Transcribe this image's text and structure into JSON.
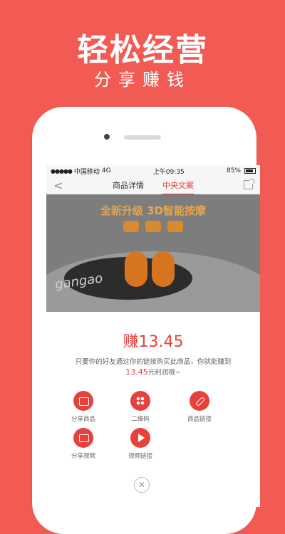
{
  "promo": {
    "headline": "轻松经营",
    "subline": "分享赚钱"
  },
  "status_bar": {
    "carrier": "中国移动",
    "network": "4G",
    "time": "上午09:35",
    "battery": "85%"
  },
  "nav": {
    "tabs": [
      {
        "label": "商品详情",
        "active": false
      },
      {
        "label": "中央文案",
        "active": true
      }
    ]
  },
  "product_banner": {
    "title": "全新升级 3D智能按摩",
    "brand": "gangao"
  },
  "earn": {
    "title": "赚13.45",
    "desc_before": "只要你的好友通过你的链接购买此商品，你就能赚到",
    "amount": "13.45",
    "desc_after": "元利润哦~"
  },
  "share_options": [
    {
      "label": "分享商品",
      "icon": "bag-icon"
    },
    {
      "label": "二维码",
      "icon": "qr-code-icon"
    },
    {
      "label": "商品链接",
      "icon": "link-icon"
    },
    {
      "label": "分享视频",
      "icon": "tv-icon"
    },
    {
      "label": "视频链接",
      "icon": "play-icon"
    }
  ],
  "colors": {
    "background": "#f25a54",
    "accent": "#e8413b"
  }
}
